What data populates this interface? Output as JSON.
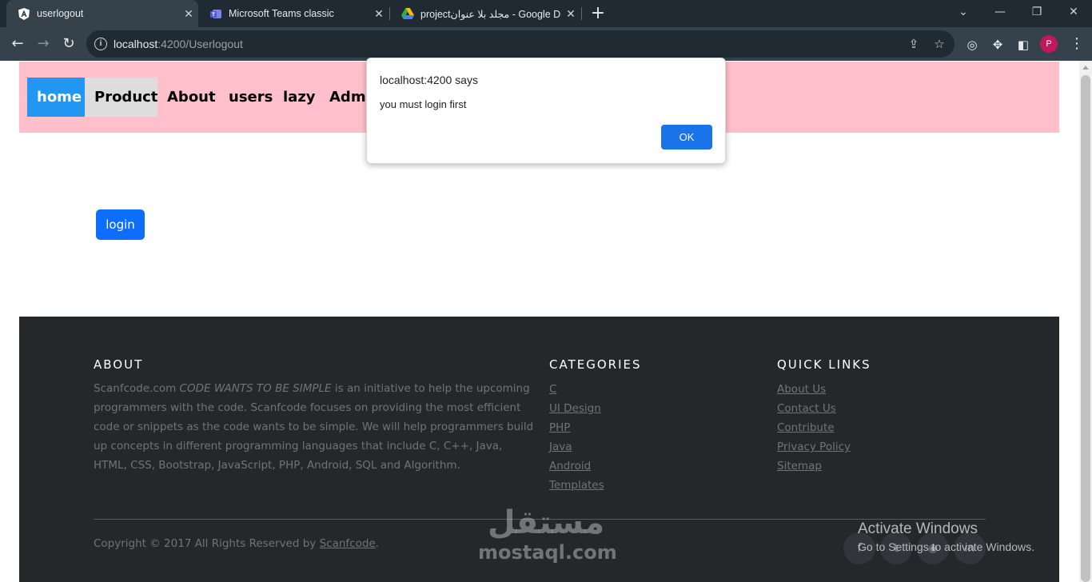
{
  "browser": {
    "tabs": [
      {
        "title": "userlogout",
        "favicon": "angular-icon",
        "active": true
      },
      {
        "title": "Microsoft Teams classic",
        "favicon": "teams-icon",
        "active": false
      },
      {
        "title": "projectمجلد بلا عنوان - Google Dr",
        "favicon": "google-drive-icon",
        "active": false
      }
    ],
    "url_host": "localhost",
    "url_rest": ":4200/Userlogout",
    "profile_initial": "P"
  },
  "nav": {
    "items": [
      {
        "label": "home"
      },
      {
        "label": "Product"
      },
      {
        "label": "About"
      },
      {
        "label": "users"
      },
      {
        "label": "lazy"
      },
      {
        "label": "Admi"
      }
    ],
    "background": "#ffc0cb",
    "active_color": "#2196f3"
  },
  "page": {
    "login_label": "login"
  },
  "footer": {
    "about": {
      "heading": "ABOUT",
      "lead": "Scanfcode.com ",
      "emphasis": "CODE WANTS TO BE SIMPLE",
      "body": " is an initiative to help the upcoming programmers with the code. Scanfcode focuses on providing the most efficient code or snippets as the code wants to be simple. We will help programmers build up concepts in different programming languages that include C, C++, Java, HTML, CSS, Bootstrap, JavaScript, PHP, Android, SQL and Algorithm."
    },
    "categories": {
      "heading": "CATEGORIES",
      "links": [
        "C",
        "UI Design",
        "PHP",
        "Java",
        "Android",
        "Templates"
      ]
    },
    "quick_links": {
      "heading": "QUICK LINKS",
      "links": [
        "About Us",
        "Contact Us",
        "Contribute",
        "Privacy Policy",
        "Sitemap"
      ]
    },
    "copyright_prefix": "Copyright © 2017 All Rights Reserved by ",
    "copyright_link": "Scanfcode",
    "copyright_suffix": ".",
    "social_icons": [
      "facebook-icon",
      "twitter-icon",
      "dribbble-icon",
      "linkedin-icon"
    ],
    "background": "#26272b"
  },
  "watermark": {
    "arabic": "مستقل",
    "latin": "mostaql.com"
  },
  "os_notice": {
    "title": "Activate Windows",
    "subtitle": "Go to Settings to activate Windows."
  },
  "alert": {
    "title": "localhost:4200 says",
    "message": "you must login first",
    "ok_label": "OK"
  }
}
